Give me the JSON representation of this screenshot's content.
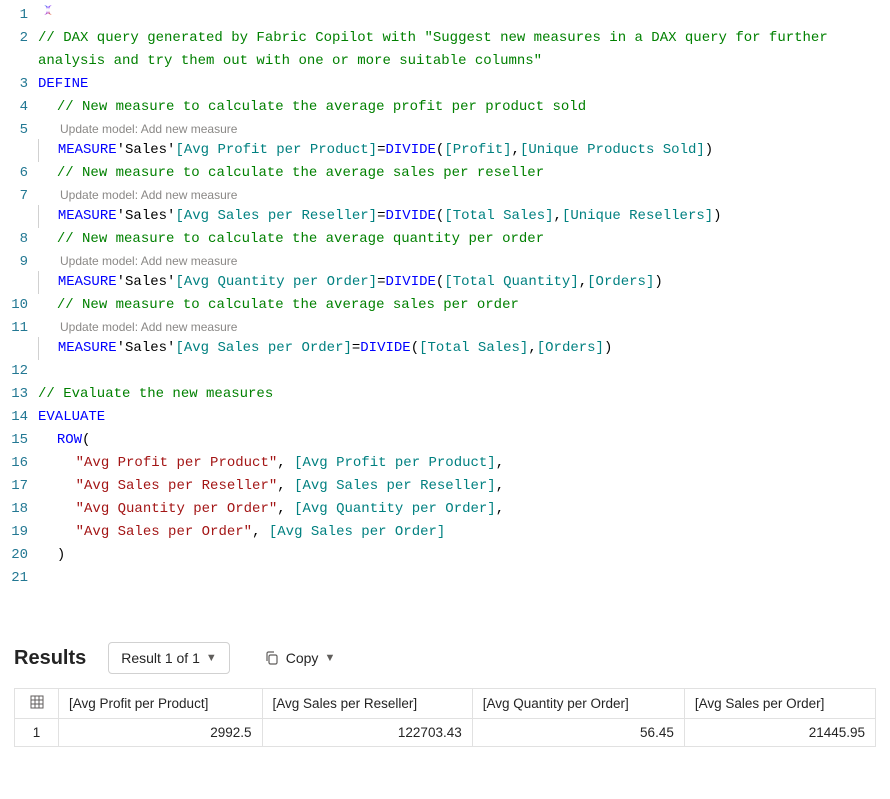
{
  "hint_text": "Update model: Add new measure",
  "lines": [
    {
      "n": 1,
      "kind": "icon"
    },
    {
      "n": 2,
      "kind": "comment2",
      "a": "// DAX query generated by Fabric Copilot with \"Suggest new measures in a DAX query for further",
      "b": "analysis and try them out with one or more suitable columns\""
    },
    {
      "n": 3,
      "kind": "kw",
      "text": "DEFINE"
    },
    {
      "n": 4,
      "kind": "commentbar",
      "text": "// New measure to calculate the average profit per product sold"
    },
    {
      "n": 5,
      "kind": "measure",
      "hint": true,
      "table": "'Sales'",
      "name": "[Avg Profit per Product]",
      "arg1": "[Profit]",
      "arg2": "[Unique Products Sold]"
    },
    {
      "n": 6,
      "kind": "commentbar",
      "text": "// New measure to calculate the average sales per reseller"
    },
    {
      "n": 7,
      "kind": "measure",
      "hint": true,
      "table": "'Sales'",
      "name": "[Avg Sales per Reseller]",
      "arg1": "[Total Sales]",
      "arg2": "[Unique Resellers]"
    },
    {
      "n": 8,
      "kind": "commentbar",
      "text": "// New measure to calculate the average quantity per order"
    },
    {
      "n": 9,
      "kind": "measure",
      "hint": true,
      "table": "'Sales'",
      "name": "[Avg Quantity per Order]",
      "arg1": "[Total Quantity]",
      "arg2": "[Orders]"
    },
    {
      "n": 10,
      "kind": "commentbar",
      "text": "// New measure to calculate the average sales per order"
    },
    {
      "n": 11,
      "kind": "measure",
      "hint": true,
      "table": "'Sales'",
      "name": "[Avg Sales per Order]",
      "arg1": "[Total Sales]",
      "arg2": "[Orders]"
    },
    {
      "n": 12,
      "kind": "blankbar"
    },
    {
      "n": 13,
      "kind": "comment",
      "text": "// Evaluate the new measures"
    },
    {
      "n": 14,
      "kind": "kw",
      "text": "EVALUATE"
    },
    {
      "n": 15,
      "kind": "rowopen",
      "text": "ROW"
    },
    {
      "n": 16,
      "kind": "rowarg",
      "label": "\"Avg Profit per Product\"",
      "ref": "[Avg Profit per Product]",
      "comma": true
    },
    {
      "n": 17,
      "kind": "rowarg",
      "label": "\"Avg Sales per Reseller\"",
      "ref": "[Avg Sales per Reseller]",
      "comma": true
    },
    {
      "n": 18,
      "kind": "rowarg",
      "label": "\"Avg Quantity per Order\"",
      "ref": "[Avg Quantity per Order]",
      "comma": true
    },
    {
      "n": 19,
      "kind": "rowarg",
      "label": "\"Avg Sales per Order\"",
      "ref": "[Avg Sales per Order]",
      "comma": false
    },
    {
      "n": 20,
      "kind": "rowclose"
    },
    {
      "n": 21,
      "kind": "blank"
    }
  ],
  "results": {
    "title": "Results",
    "pager": "Result 1 of 1",
    "copy": "Copy",
    "columns": [
      "[Avg Profit per Product]",
      "[Avg Sales per Reseller]",
      "[Avg Quantity per Order]",
      "[Avg Sales per Order]"
    ],
    "rows": [
      {
        "i": "1",
        "cells": [
          "2992.5",
          "122703.43",
          "56.45",
          "21445.95"
        ]
      }
    ]
  }
}
